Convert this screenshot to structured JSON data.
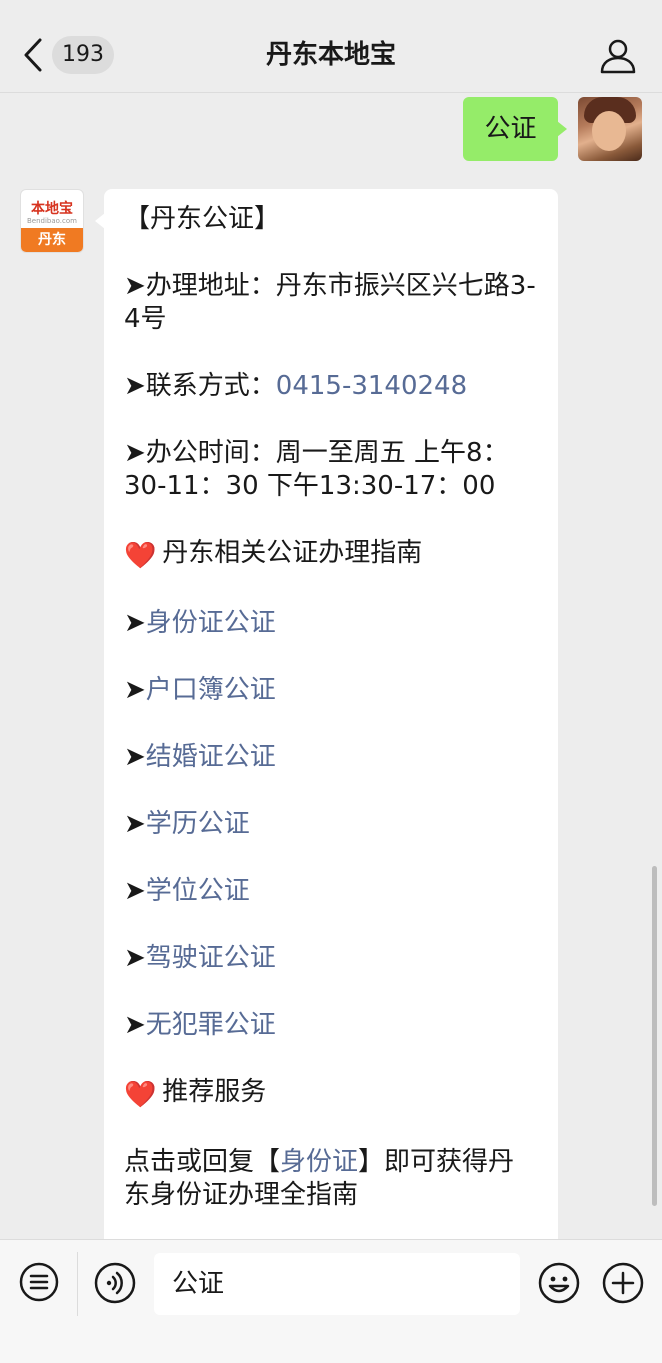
{
  "header": {
    "unread_count": "193",
    "title": "丹东本地宝"
  },
  "messages": {
    "outgoing_text": "公证",
    "bot_logo_top": "本地宝",
    "bot_logo_sub": "Bendibao.com",
    "bot_logo_bottom": "丹东",
    "incoming": {
      "heading": "【丹东公证】",
      "address": "➤办理地址：丹东市振兴区兴七路3-4号",
      "contact_label": "➤联系方式：",
      "contact_phone": "0415-3140248",
      "hours": "➤办公时间：周一至周五 上午8：30-11：30 下午13:30-17：00",
      "guide_heart": "❤️",
      "guide_title": "丹东相关公证办理指南",
      "arrow": "➤",
      "links": [
        "身份证公证",
        "户口簿公证",
        "结婚证公证",
        "学历公证",
        "学位公证",
        "驾驶证公证",
        "无犯罪公证"
      ],
      "recommend_heart": "❤️",
      "recommend_title": "推荐服务",
      "tip_prefix": "点击或回复【",
      "tip_link": "身份证",
      "tip_suffix": "】即可获得丹东身份证办理全指南"
    }
  },
  "input_bar": {
    "value": "公证"
  },
  "colors": {
    "outgoing_bubble": "#95ec69",
    "link": "#576b95",
    "background": "#ededed"
  }
}
